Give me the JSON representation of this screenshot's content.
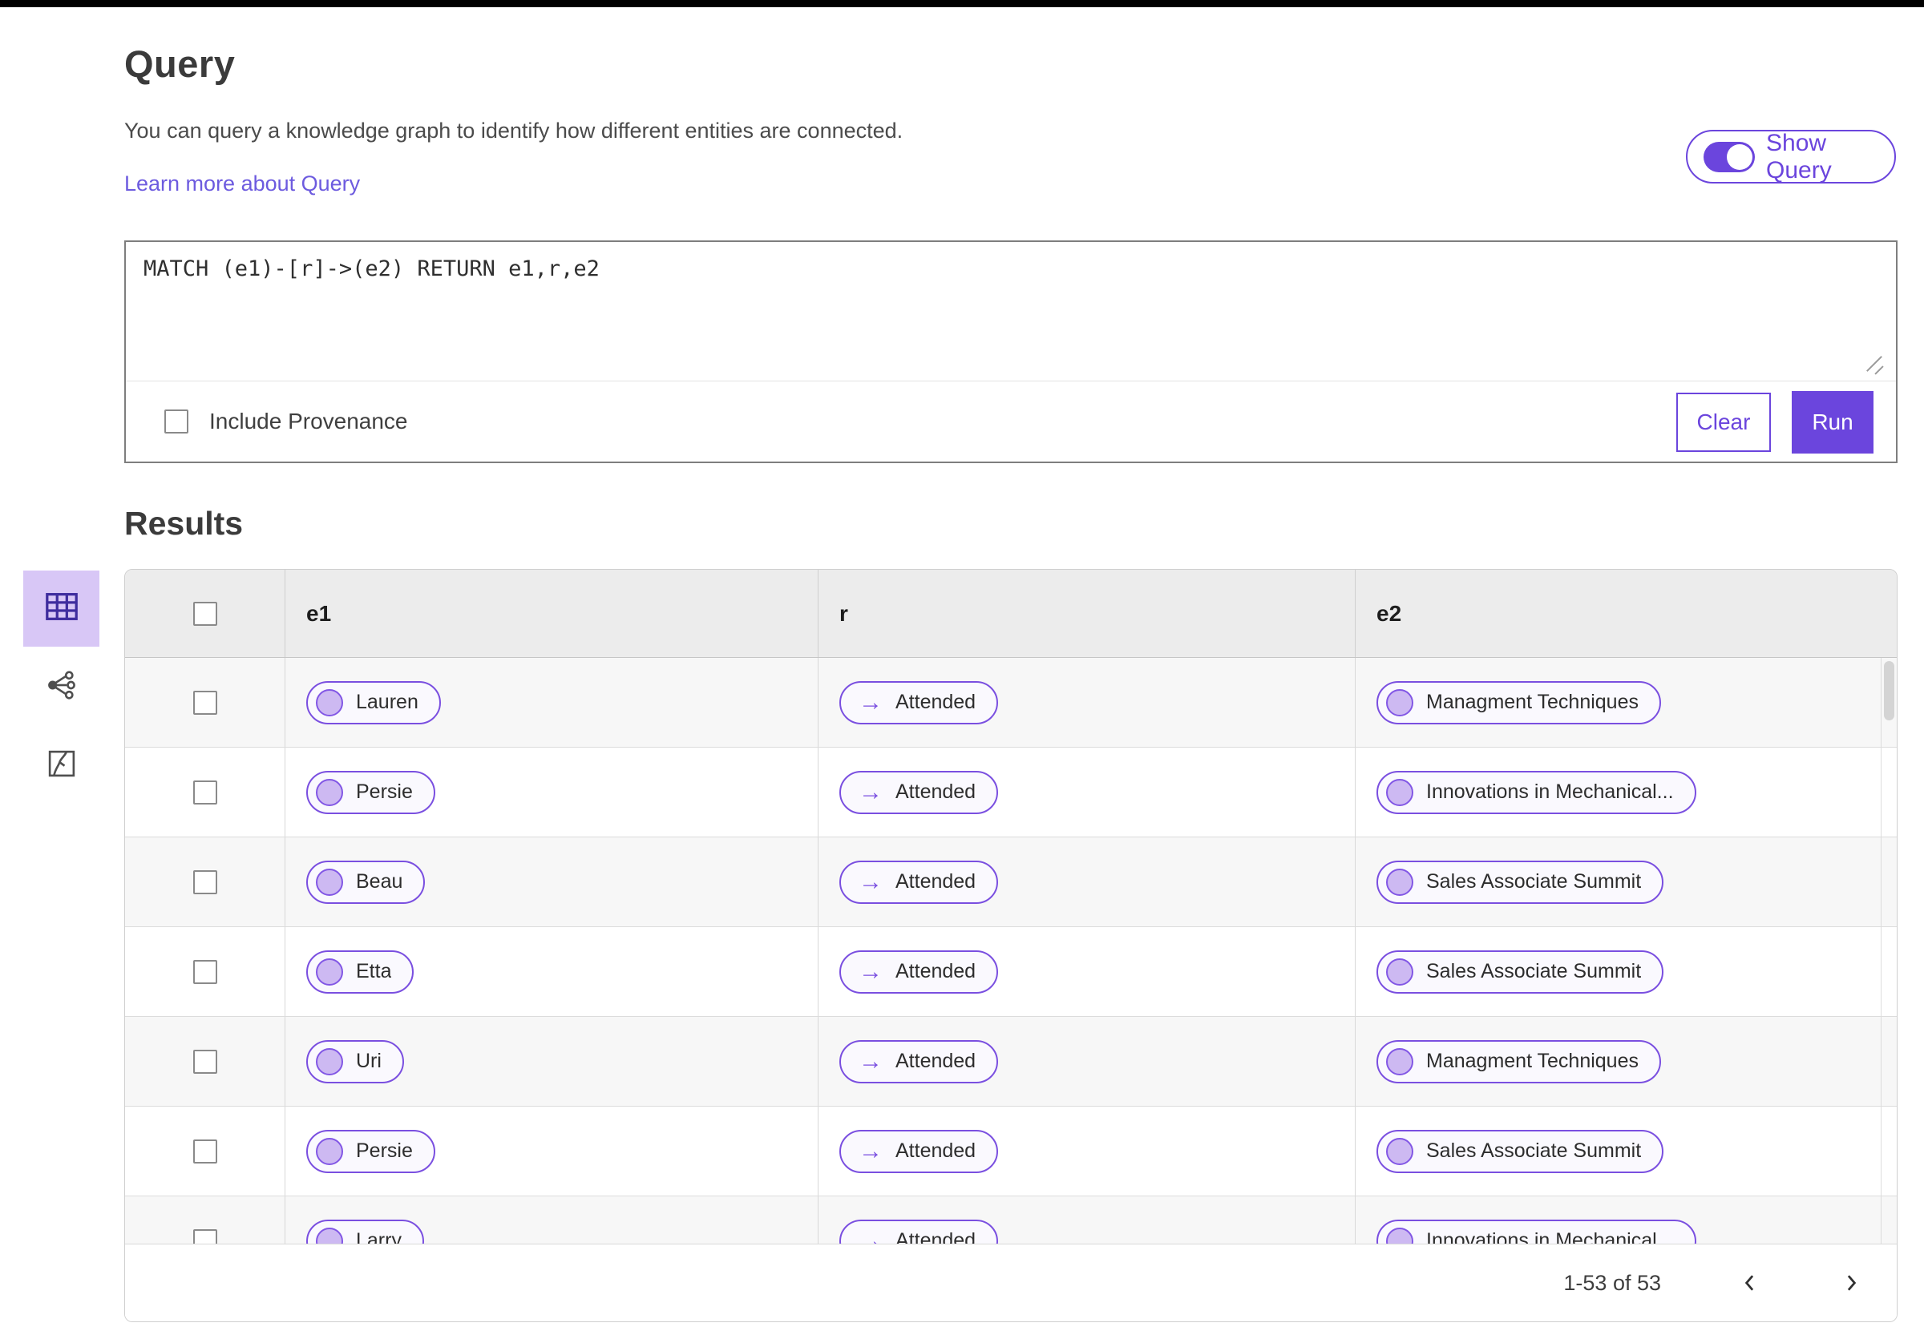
{
  "header": {
    "title": "Query",
    "description": "You can query a knowledge graph to identify how different entities are connected.",
    "learn_more_link": "Learn more about Query",
    "show_query_toggle": {
      "label": "Show Query",
      "state": "on"
    }
  },
  "query_editor": {
    "query_text": "MATCH (e1)-[r]->(e2) RETURN e1,r,e2",
    "include_provenance": {
      "label": "Include Provenance",
      "checked": false
    },
    "clear_button_label": "Clear",
    "run_button_label": "Run"
  },
  "results": {
    "title": "Results",
    "view_switcher": [
      {
        "name": "table-view",
        "selected": true
      },
      {
        "name": "graph-view",
        "selected": false
      },
      {
        "name": "map-view",
        "selected": false
      }
    ],
    "table": {
      "columns": [
        "e1",
        "r",
        "e2"
      ],
      "rows": [
        {
          "e1": "Lauren",
          "r": "Attended",
          "e2": "Managment Techniques"
        },
        {
          "e1": "Persie",
          "r": "Attended",
          "e2": "Innovations in Mechanical..."
        },
        {
          "e1": "Beau",
          "r": "Attended",
          "e2": "Sales Associate Summit"
        },
        {
          "e1": "Etta",
          "r": "Attended",
          "e2": "Sales Associate Summit"
        },
        {
          "e1": "Uri",
          "r": "Attended",
          "e2": "Managment Techniques"
        },
        {
          "e1": "Persie",
          "r": "Attended",
          "e2": "Sales Associate Summit"
        },
        {
          "e1": "Larry",
          "r": "Attended",
          "e2": "Innovations in Mechanical..."
        }
      ]
    },
    "pagination": {
      "range_text": "1-53 of 53"
    }
  },
  "icons": {
    "relationship_arrow": "→"
  },
  "colors": {
    "accent_purple": "#6b45dd",
    "pill_border": "#7a4fe0",
    "pill_bg": "#faf9fe",
    "pill_dot_fill": "#cdb9f2",
    "selected_view_bg": "#d8c7f6",
    "link": "#6d5bdf",
    "table_header_bg": "#ececec",
    "row_stripe_bg": "#f7f7f7"
  }
}
